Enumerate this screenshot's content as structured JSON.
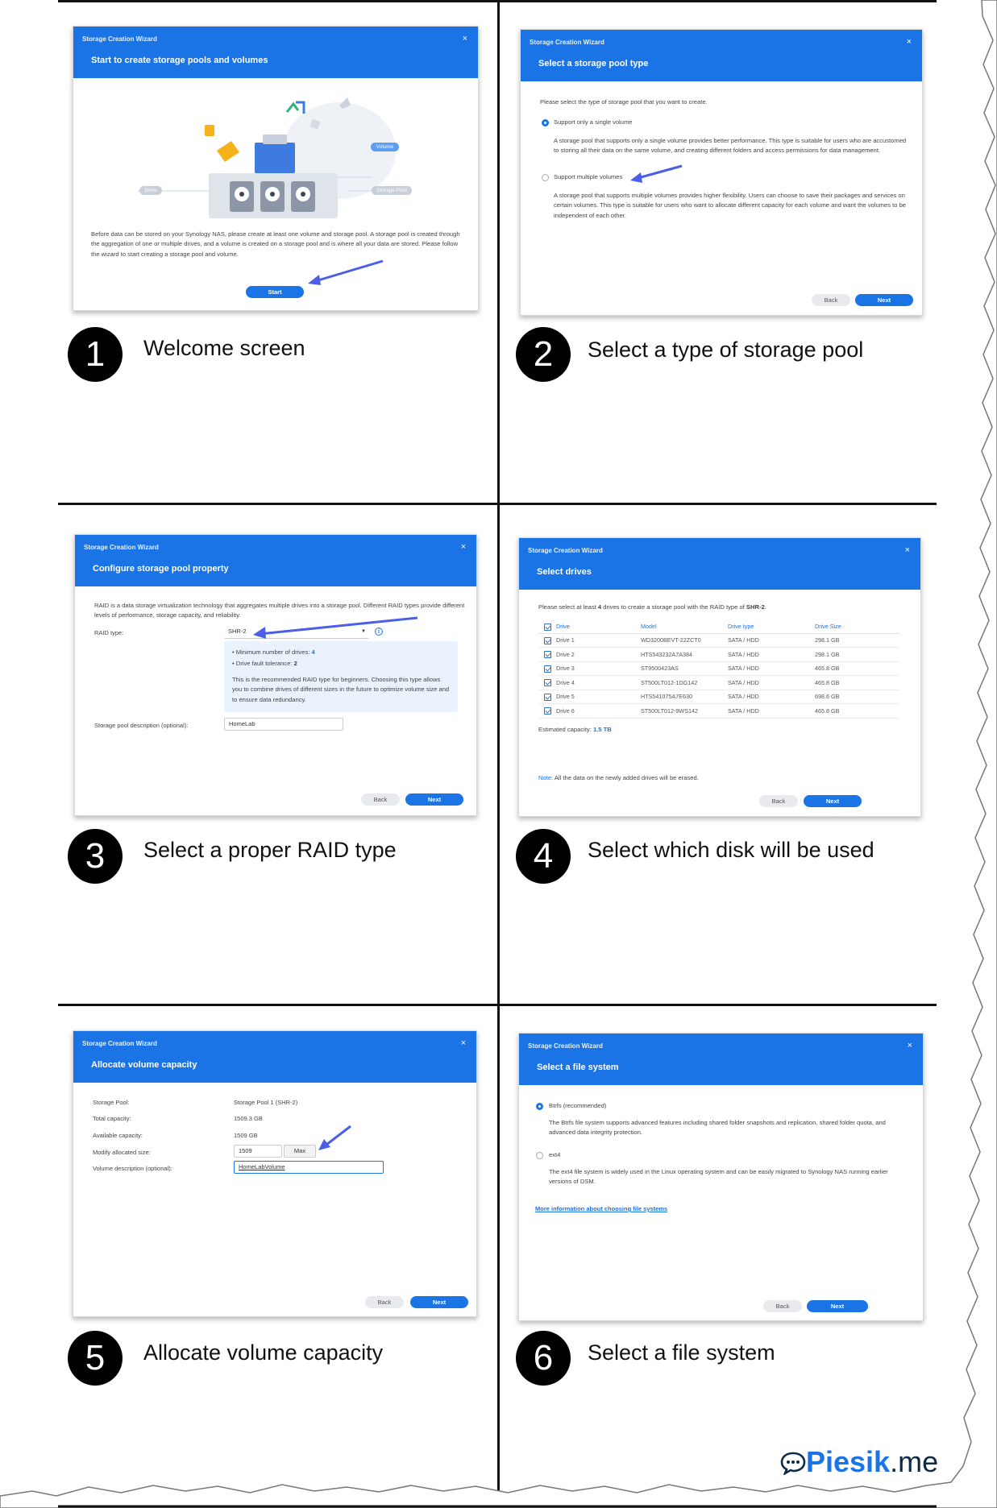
{
  "steps": [
    {
      "num": "1",
      "caption": "Welcome screen"
    },
    {
      "num": "2",
      "caption": "Select a type of storage pool"
    },
    {
      "num": "3",
      "caption": "Select a proper RAID type"
    },
    {
      "num": "4",
      "caption": "Select which disk will be used"
    },
    {
      "num": "5",
      "caption": "Allocate volume capacity"
    },
    {
      "num": "6",
      "caption": "Select a file system"
    }
  ],
  "wizard_title": "Storage Creation Wizard",
  "close_glyph": "×",
  "back_label": "Back",
  "next_label": "Next",
  "s1": {
    "subtitle": "Start to create storage pools and volumes",
    "label_volume": "Volume",
    "label_drive": "Drive",
    "label_storage_pool": "Storage Pool",
    "desc": "Before data can be stored on your Synology NAS, please create at least one volume and storage pool. A storage pool is created through the aggregation of one or multiple drives, and a volume is created on a storage pool and is where all your data are stored. Please follow the wizard to start creating a storage pool and volume.",
    "start": "Start"
  },
  "s2": {
    "subtitle": "Select a storage pool type",
    "intro": "Please select the type of storage pool that you want to create.",
    "opt1": "Support only a single volume",
    "opt1_desc": "A storage pool that supports only a single volume provides better performance. This type is suitable for users who are accustomed to storing all their data on the same volume, and creating different folders and access permissions for data management.",
    "opt2": "Support multiple volumes",
    "opt2_desc": "A storage pool that supports multiple volumes provides higher flexibility. Users can choose to save their packages and services on certain volumes. This type is suitable for users who want to allocate different capacity for each volume and want the volumes to be independent of each other."
  },
  "s3": {
    "subtitle": "Configure storage pool property",
    "intro": "RAID is a data storage virtualization technology that aggregates multiple drives into a storage pool. Different RAID types provide different levels of performance, storage capacity, and reliability.",
    "raid_label": "RAID type:",
    "raid_value": "SHR-2",
    "min_drives_label": "Minimum number of drives:",
    "min_drives": "4",
    "fault_label": "Drive fault tolerance:",
    "fault": "2",
    "recommend": "This is the recommended RAID type for beginners. Choosing this type allows you to combine drives of different sizes in the future to optimize volume size and to ensure data redundancy.",
    "desc_label": "Storage pool description (optional):",
    "desc_value": "HomeLab"
  },
  "s4": {
    "subtitle": "Select drives",
    "intro_a": "Please select at least ",
    "intro_n": "4",
    "intro_b": " drives to create a storage pool with the RAID type of ",
    "intro_raid": "SHR-2",
    "headers": [
      "Drive",
      "Model",
      "Drive type",
      "Drive Size"
    ],
    "rows": [
      [
        "Drive 1",
        "WD3200BEVT-22ZCT0",
        "SATA / HDD",
        "298.1 GB"
      ],
      [
        "Drive 2",
        "HTS543232A7A384",
        "SATA / HDD",
        "298.1 GB"
      ],
      [
        "Drive 3",
        "ST9500423AS",
        "SATA / HDD",
        "465.8 GB"
      ],
      [
        "Drive 4",
        "ST500LT012-1DG142",
        "SATA / HDD",
        "465.8 GB"
      ],
      [
        "Drive 5",
        "HTS541075A7E630",
        "SATA / HDD",
        "698.6 GB"
      ],
      [
        "Drive 6",
        "ST500LT012-9WS142",
        "SATA / HDD",
        "465.8 GB"
      ]
    ],
    "est_label": "Estimated capacity:",
    "est_value": "1.5 TB",
    "note_label": "Note:",
    "note_text": "All the data on the newly added drives will be erased."
  },
  "s5": {
    "subtitle": "Allocate volume capacity",
    "pool_label": "Storage Pool:",
    "pool_value": "Storage Pool 1 (SHR-2)",
    "total_label": "Total capacity:",
    "total_value": "1509.3 GB",
    "avail_label": "Available capacity:",
    "avail_value": "1509 GB",
    "modify_label": "Modify allocated size:",
    "modify_value": "1509",
    "max": "Max",
    "vdesc_label": "Volume description (optional):",
    "vdesc_value": "HomeLabVolume"
  },
  "s6": {
    "subtitle": "Select a file system",
    "opt1": "Btrfs (recommended)",
    "opt1_desc": "The Btrfs file system supports advanced features including shared folder snapshots and replication, shared folder quota, and advanced data integrity protection.",
    "opt2": "ext4",
    "opt2_desc": "The ext4 file system is widely used in the Linux operating system and can be easily migrated to Synology NAS running earlier versions of DSM.",
    "link": "More information about choosing file systems"
  },
  "brand": {
    "name": "Piesik",
    "suffix": ".me",
    "color": "#1a74e6"
  }
}
